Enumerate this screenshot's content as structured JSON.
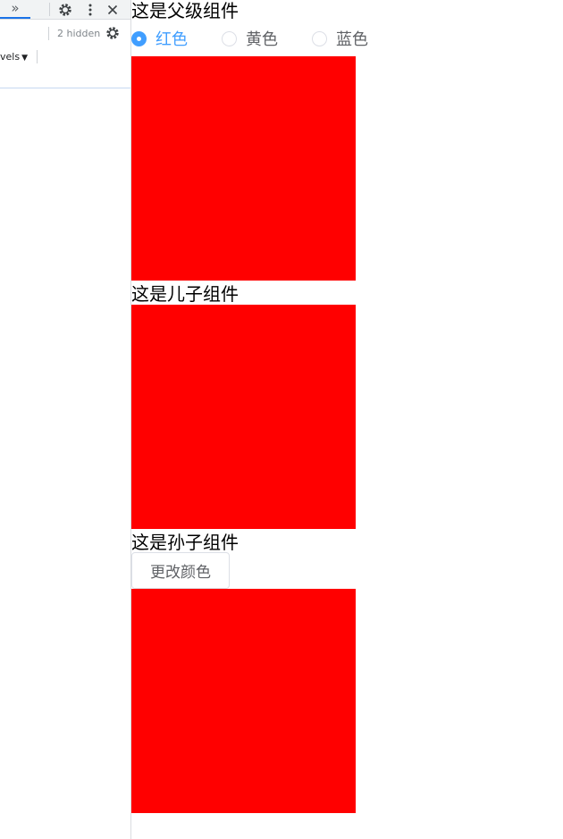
{
  "devtools": {
    "more_tabs_label": "»",
    "hidden_count": "2 hidden",
    "levels_label": "vels"
  },
  "parent": {
    "title": "这是父级组件",
    "radios": [
      {
        "label": "红色",
        "checked": true
      },
      {
        "label": "黄色",
        "checked": false
      },
      {
        "label": "蓝色",
        "checked": false
      }
    ],
    "box_color": "#ff0000"
  },
  "child": {
    "title": "这是儿子组件",
    "box_color": "#ff0000"
  },
  "grandchild": {
    "title": "这是孙子组件",
    "button_label": "更改颜色",
    "box_color": "#ff0000"
  },
  "colors": {
    "accent": "#409eff",
    "radio_text": "#606266",
    "box": "#ff0000"
  }
}
